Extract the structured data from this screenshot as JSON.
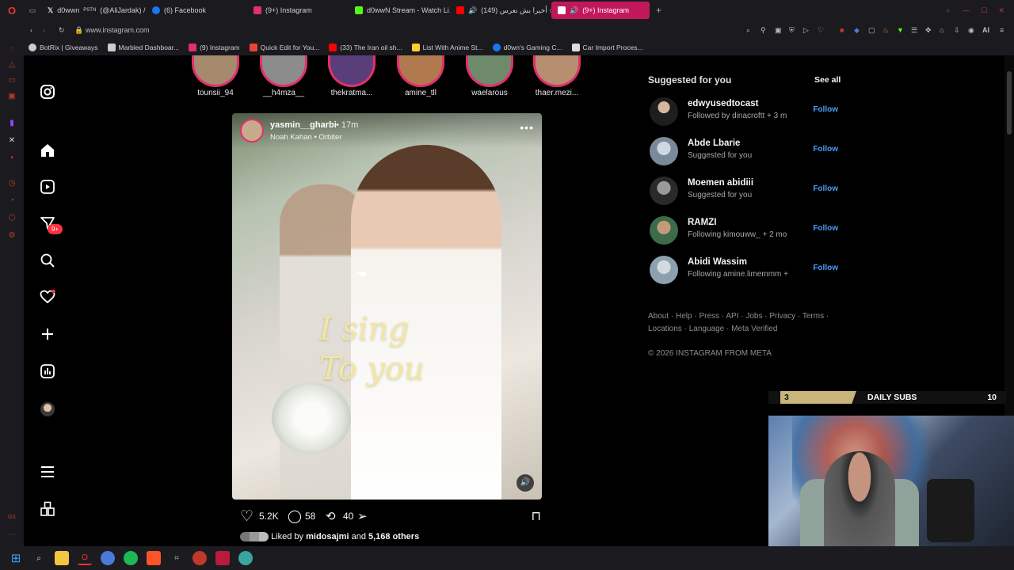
{
  "browser": {
    "tabs": [
      {
        "label": "d0wwn",
        "tag": "PSTN",
        "extra": "(@AliJardak) /",
        "color": "#dddddd"
      },
      {
        "label": "X",
        "color": "#dddddd"
      },
      {
        "label": "(6) Facebook",
        "color": "#1877f2"
      },
      {
        "label": "(9+) Instagram",
        "color": "#e1306c"
      },
      {
        "label": "d0wwN Stream - Watch Li...",
        "color": "#53fc18"
      },
      {
        "label": "أخيرا بش نعرس (149) ○ -ə",
        "color": "#ff0000"
      },
      {
        "label": "(9+) Instagram",
        "color": "#e1306c",
        "active": true
      }
    ],
    "url": "www.instagram.com",
    "bookmarks": [
      {
        "label": "BotRix | Giveaways",
        "color": "#bbbbbb"
      },
      {
        "label": "Marbled Dashboar...",
        "color": "#bbbbbb"
      },
      {
        "label": "(9) Instagram",
        "color": "#e1306c"
      },
      {
        "label": "Quick Edit for You...",
        "color": "#ea4335"
      },
      {
        "label": "(33) The Iran oil sh...",
        "color": "#ff0000"
      },
      {
        "label": "List With Anime St...",
        "color": "#ffcc33"
      },
      {
        "label": "d0wn's Gaming C...",
        "color": "#1877f2"
      },
      {
        "label": "Car Import Proces...",
        "color": "#bbbbbb"
      }
    ],
    "toolbar_label": "AI"
  },
  "instagram": {
    "nav_badge": "9+",
    "stories": [
      "tounsii_94",
      "__h4mza__",
      "thekratma...",
      "amine_tll",
      "waelarous",
      "thaer.mezi..."
    ],
    "post": {
      "username": "yasmin__gharbi",
      "time": "• 17m",
      "audio": "Noah Kahan • Orbiter",
      "overlay_line1": "I sing",
      "overlay_line2": "To you",
      "likes": "5.2K",
      "comments": "58",
      "reposts": "40",
      "liked_by_prefix": "Liked by",
      "liked_by_user": "midosajmi",
      "liked_by_and": "and",
      "liked_by_others": "5,168 others"
    },
    "suggested": {
      "title": "Suggested for you",
      "see_all": "See all",
      "follow_label": "Follow",
      "users": [
        {
          "name": "edwyusedtocast",
          "sub": "Followed by dinacroftt + 3 m"
        },
        {
          "name": "Abde Lbarie",
          "sub": "Suggested for you"
        },
        {
          "name": "Moemen abidiii",
          "sub": "Suggested for you"
        },
        {
          "name": "RAMZI",
          "sub": "Following kimouww_ + 2 mo"
        },
        {
          "name": "Abidi Wassim",
          "sub": "Following amine.limemmm +"
        }
      ]
    },
    "footer": {
      "line1": "About · Help · Press · API · Jobs · Privacy · Terms ·",
      "line2": "Locations · Language · Meta Verified",
      "copyright": "© 2026 INSTAGRAM FROM META"
    }
  },
  "overlay": {
    "subs_current": "3",
    "subs_label": "DAILY SUBS",
    "subs_goal": "10",
    "progress_fraction": 0.3
  },
  "colors": {
    "accent": "#4a9df8",
    "story_ring": "#e1306c",
    "opera_red": "#c0392b"
  }
}
